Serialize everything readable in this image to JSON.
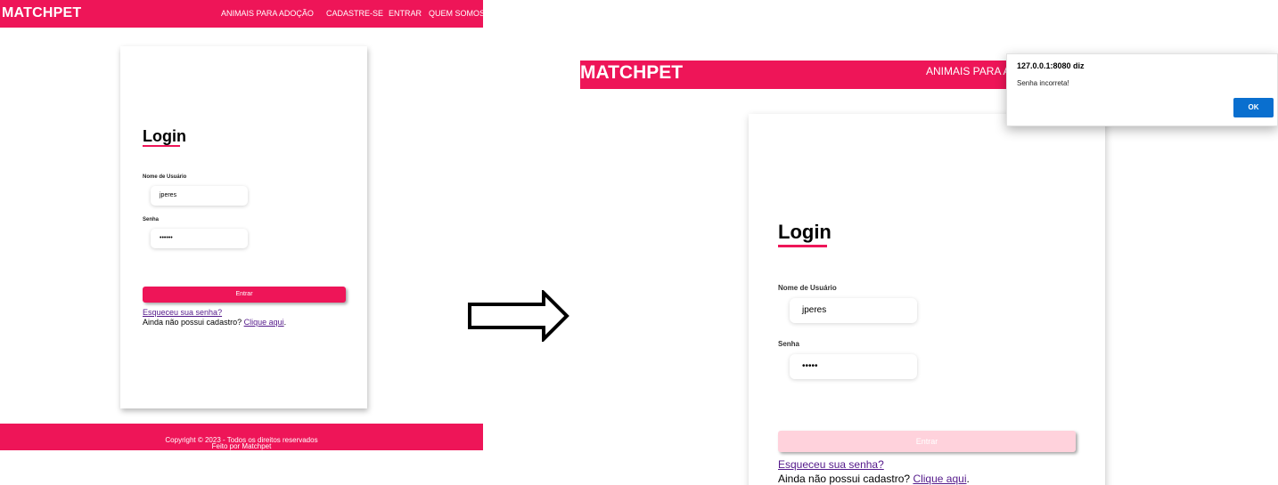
{
  "before": {
    "brand": "MATCHPET",
    "nav": [
      "ANIMAIS PARA ADOÇÃO",
      "CADASTRE-SE",
      "ENTRAR",
      "QUEM SOMOS"
    ],
    "login_title": "Login",
    "username_label": "Nome de Usuário",
    "username_value": "jperes",
    "password_label": "Senha",
    "password_value": "••••••",
    "submit_label": "Entrar",
    "forgot_link": "Esqueceu sua senha?",
    "register_prefix": "Ainda não possui cadastro? ",
    "register_link": "Clique aqui",
    "register_suffix": ".",
    "footer_copyright": "Copyright © 2023 - Todos os direitos reservados",
    "footer_made_by": "Feito por Matchpet"
  },
  "after": {
    "brand": "MATCHPET",
    "nav_visible": "ANIMAIS PARA ADOÇÃO",
    "login_title": "Login",
    "username_label": "Nome de Usuário",
    "username_value": "jperes",
    "password_label": "Senha",
    "password_value": "•••••",
    "submit_label": "Entrar",
    "forgot_link": "Esqueceu sua senha?",
    "register_prefix": "Ainda não possui cadastro? ",
    "register_link": "Clique aqui",
    "register_suffix": "."
  },
  "dialog": {
    "title": "127.0.0.1:8080 diz",
    "message": "Senha incorreta!",
    "ok_label": "OK"
  },
  "colors": {
    "brand_pink": "#ee1558",
    "disabled_button": "#ffd2dc",
    "dialog_button": "#0a6fcf",
    "link_visited": "#551a8b"
  },
  "icons": {
    "transition": "right-arrow-icon"
  }
}
